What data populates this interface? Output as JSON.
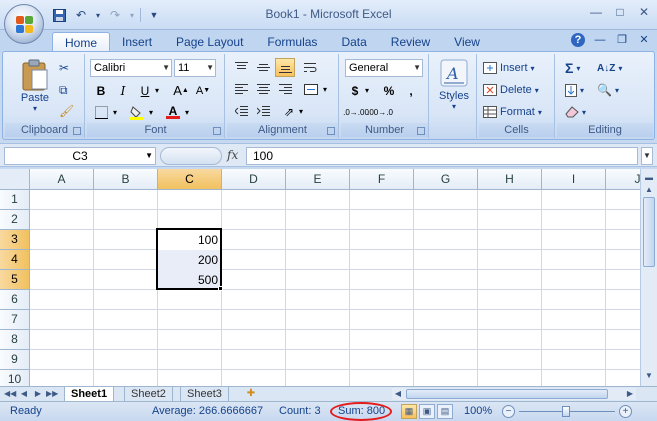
{
  "window": {
    "title": "Book1 - Microsoft Excel",
    "controls": [
      "minimize",
      "maximize",
      "close"
    ]
  },
  "quick_access": [
    "save",
    "undo",
    "redo",
    "customize"
  ],
  "ribbon_tabs": [
    "Home",
    "Insert",
    "Page Layout",
    "Formulas",
    "Data",
    "Review",
    "View"
  ],
  "active_tab": "Home",
  "ribbon": {
    "clipboard": {
      "label": "Clipboard",
      "paste": "Paste"
    },
    "font": {
      "label": "Font",
      "family": "Calibri",
      "size": "11",
      "bold": "B",
      "italic": "I",
      "underline": "U"
    },
    "alignment": {
      "label": "Alignment"
    },
    "number": {
      "label": "Number",
      "format": "General",
      "currency": "$",
      "percent": "%",
      "comma": ",",
      "increase_decimal": ".0→.00",
      "decrease_decimal": ".00→.0"
    },
    "styles": {
      "label": "Styles"
    },
    "cells": {
      "label": "Cells",
      "insert": "Insert",
      "delete": "Delete",
      "format": "Format"
    },
    "editing": {
      "label": "Editing",
      "sum": "Σ"
    }
  },
  "formula_bar": {
    "name_box": "C3",
    "fx": "fx",
    "value": "100"
  },
  "grid": {
    "columns": [
      "A",
      "B",
      "C",
      "D",
      "E",
      "F",
      "G",
      "H",
      "I",
      "J"
    ],
    "rows": [
      "1",
      "2",
      "3",
      "4",
      "5",
      "6",
      "7",
      "8",
      "9",
      "10"
    ],
    "selected_column": "C",
    "selected_rows": [
      "3",
      "4",
      "5"
    ],
    "cells": {
      "C3": "100",
      "C4": "200",
      "C5": "500"
    }
  },
  "sheets": [
    "Sheet1",
    "Sheet2",
    "Sheet3"
  ],
  "active_sheet": "Sheet1",
  "status": {
    "ready": "Ready",
    "average": "Average: 266.6666667",
    "count": "Count: 3",
    "sum": "Sum: 800",
    "zoom": "100%"
  },
  "colors": {
    "selected_header": "#f1c15f",
    "sum_highlight": "#e41c1c",
    "ribbon_bg": "#d9e6f7"
  }
}
